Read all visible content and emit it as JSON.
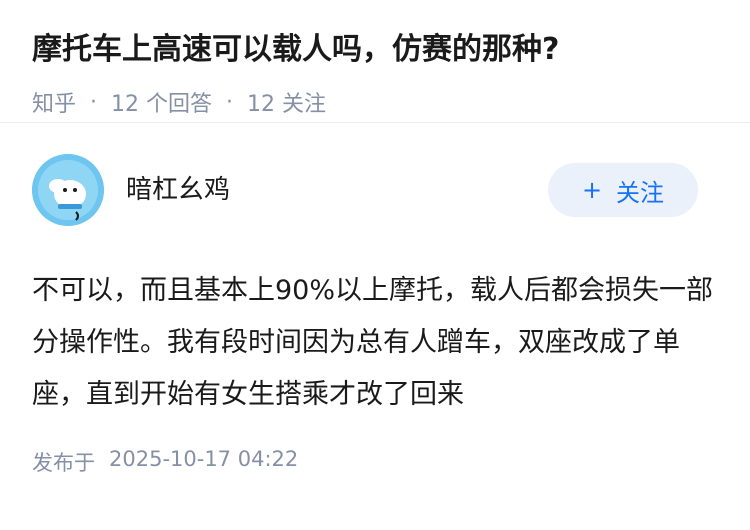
{
  "question": {
    "title": "摩托车上高速可以载人吗，仿赛的那种?",
    "source": "知乎",
    "answers_count": "12 个回答",
    "followers_count": "12 关注",
    "separator": "·"
  },
  "answer": {
    "author_name": "暗杠幺鸡",
    "follow_label": "关注",
    "follow_icon": "+",
    "content": "不可以，而且基本上90%以上摩托，载人后都会损失一部分操作性。我有段时间因为总有人蹭车，双座改成了单座，直到开始有女生搭乘才改了回来",
    "published_label": "发布于",
    "published_date": "2025-10-17 04:22"
  },
  "colors": {
    "accent": "#1772f6",
    "meta_gray": "#8590a6",
    "avatar_bg": "#6ec6f0"
  }
}
